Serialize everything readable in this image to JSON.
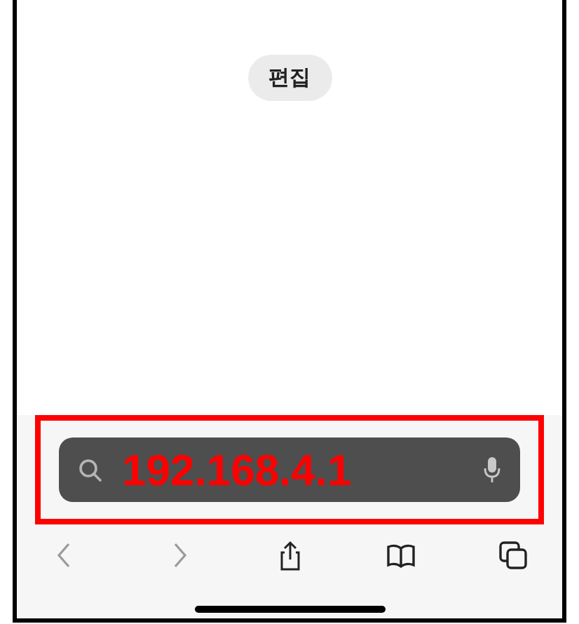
{
  "edit_button": {
    "label": "편집"
  },
  "address_bar": {
    "value": "192.168.4.1",
    "highlighted": true
  },
  "toolbar": [
    {
      "kind": "back",
      "disabled": true
    },
    {
      "kind": "forward",
      "disabled": true
    },
    {
      "kind": "share",
      "disabled": false
    },
    {
      "kind": "bookmarks",
      "disabled": false
    },
    {
      "kind": "tabs",
      "disabled": false
    }
  ]
}
